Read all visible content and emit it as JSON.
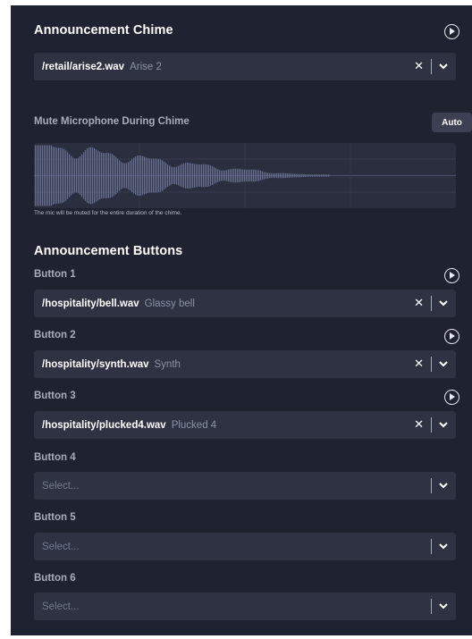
{
  "chime": {
    "title": "Announcement Chime",
    "path": "/retail/arise2.wav",
    "name": "Arise 2"
  },
  "mute": {
    "title": "Mute Microphone During Chime",
    "auto_label": "Auto",
    "note": "The mic will be muted for the entire duration of the chime."
  },
  "buttons_section": {
    "title": "Announcement Buttons",
    "items": [
      {
        "label": "Button 1",
        "path": "/hospitality/bell.wav",
        "name": "Glassy bell"
      },
      {
        "label": "Button 2",
        "path": "/hospitality/synth.wav",
        "name": "Synth"
      },
      {
        "label": "Button 3",
        "path": "/hospitality/plucked4.wav",
        "name": "Plucked 4"
      },
      {
        "label": "Button 4",
        "placeholder": "Select..."
      },
      {
        "label": "Button 5",
        "placeholder": "Select..."
      },
      {
        "label": "Button 6",
        "placeholder": "Select..."
      }
    ]
  },
  "icons": {
    "clear": "close-icon",
    "dropdown": "chevron-down-icon",
    "play": "play-icon"
  },
  "colors": {
    "panel_bg": "#1f2230",
    "field_bg": "#2e3242",
    "waveform": "#5b6fb0",
    "text_primary": "#ffffff",
    "text_muted": "#a8adbd"
  }
}
